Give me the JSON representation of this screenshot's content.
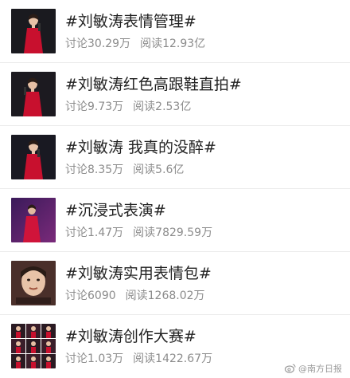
{
  "items": [
    {
      "title": "#刘敏涛表情管理#",
      "discuss": "讨论30.29万",
      "read": "阅读12.93亿",
      "thumb_icon": "woman-red-dress-singing-thumbnail"
    },
    {
      "title": "#刘敏涛红色高跟鞋直拍#",
      "discuss": "讨论9.73万",
      "read": "阅读2.53亿",
      "thumb_icon": "woman-red-dress-singing-thumbnail"
    },
    {
      "title": "#刘敏涛 我真的没醉#",
      "discuss": "讨论8.35万",
      "read": "阅读5.6亿",
      "thumb_icon": "woman-red-dress-singing-thumbnail"
    },
    {
      "title": "#沉浸式表演#",
      "discuss": "讨论1.47万",
      "read": "阅读7829.59万",
      "thumb_icon": "woman-red-dress-stage-thumbnail"
    },
    {
      "title": "#刘敏涛实用表情包#",
      "discuss": "讨论6090",
      "read": "阅读1268.02万",
      "thumb_icon": "face-closeup-thumbnail"
    },
    {
      "title": "#刘敏涛创作大赛#",
      "discuss": "讨论1.03万",
      "read": "阅读1422.67万",
      "thumb_icon": "collage-thumbnail"
    }
  ],
  "watermark": {
    "text": "@南方日报",
    "icon": "weibo-logo-icon"
  },
  "colors": {
    "title": "#222222",
    "meta": "#8c8c8c",
    "divider": "#ececec",
    "accent_red": "#c8102e"
  }
}
